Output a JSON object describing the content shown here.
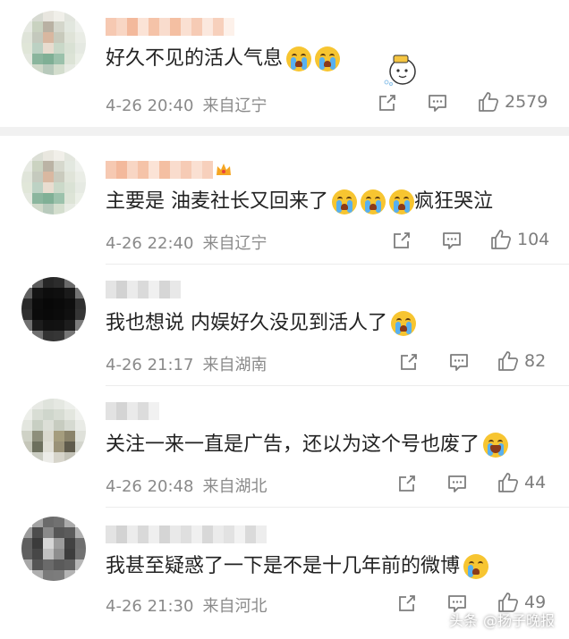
{
  "comments": [
    {
      "text": "好久不见的活人气息",
      "emojis": [
        "cry",
        "cry"
      ],
      "date": "4-26 20:40",
      "source": "来自辽宁",
      "likes": "2579"
    },
    {
      "text": "主要是 油麦社长又回来了",
      "emojis": [
        "cry",
        "cry",
        "cry"
      ],
      "text_after": "疯狂哭泣",
      "date": "4-26 22:40",
      "source": "来自辽宁",
      "likes": "104"
    },
    {
      "text": "我也想说  内娱好久没见到活人了",
      "emojis": [
        "cry"
      ],
      "date": "4-26 21:17",
      "source": "来自湖南",
      "likes": "82"
    },
    {
      "text": "关注一来一直是广告，还以为这个号也废了",
      "emojis": [
        "laugh-cry"
      ],
      "date": "4-26 20:48",
      "source": "来自湖北",
      "likes": "44"
    },
    {
      "text": "我甚至疑惑了一下是不是十几年前的微博",
      "emojis": [
        "sad"
      ],
      "date": "4-26 21:30",
      "source": "来自河北",
      "likes": "49"
    }
  ],
  "watermark": {
    "source": "头条",
    "account": "@扬子晚报"
  },
  "icons": {
    "share": "share-icon",
    "comment": "comment-icon",
    "like": "thumbs-up-icon"
  },
  "colors": {
    "meta": "#8a8a8a",
    "text": "#222222",
    "emoji": "#f7c531",
    "badge": "#f5a623"
  }
}
